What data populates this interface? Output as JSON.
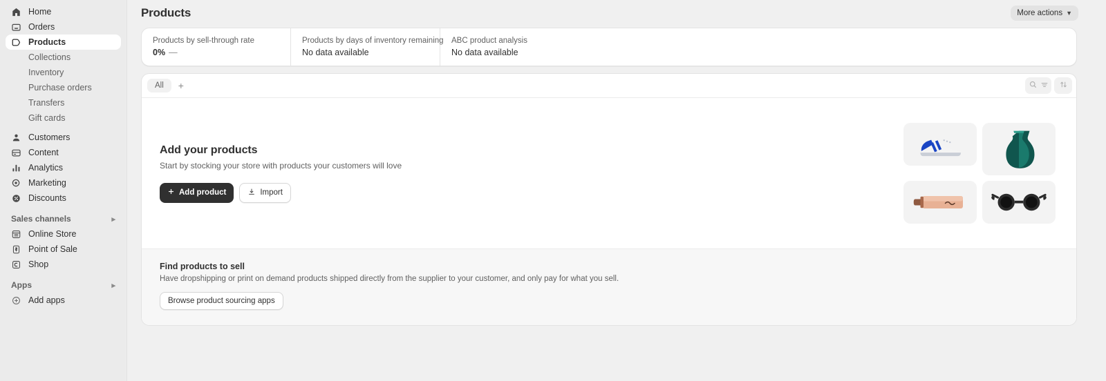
{
  "sidebar": {
    "primary": [
      {
        "label": "Home",
        "icon": "home-icon",
        "selected": false
      },
      {
        "label": "Orders",
        "icon": "orders-icon",
        "selected": false
      },
      {
        "label": "Products",
        "icon": "products-tag-icon",
        "selected": true
      }
    ],
    "product_subitems": [
      {
        "label": "Collections"
      },
      {
        "label": "Inventory"
      },
      {
        "label": "Purchase orders"
      },
      {
        "label": "Transfers"
      },
      {
        "label": "Gift cards"
      }
    ],
    "secondary": [
      {
        "label": "Customers",
        "icon": "customer-icon"
      },
      {
        "label": "Content",
        "icon": "content-icon"
      },
      {
        "label": "Analytics",
        "icon": "analytics-bars-icon"
      },
      {
        "label": "Marketing",
        "icon": "marketing-target-icon"
      },
      {
        "label": "Discounts",
        "icon": "discount-tag-icon"
      }
    ],
    "sales_channels": {
      "title": "Sales channels",
      "chevron": "chevron-right-icon",
      "items": [
        {
          "label": "Online Store",
          "icon": "online-store-icon"
        },
        {
          "label": "Point of Sale",
          "icon": "point-of-sale-icon"
        },
        {
          "label": "Shop",
          "icon": "shop-icon"
        }
      ]
    },
    "apps": {
      "title": "Apps",
      "chevron": "chevron-right-icon",
      "items": [
        {
          "label": "Add apps",
          "icon": "plus-circle-icon"
        }
      ]
    }
  },
  "header": {
    "title": "Products",
    "more_actions_label": "More actions",
    "more_actions_icon": "chevron-down-icon"
  },
  "metrics": [
    {
      "label": "Products by sell-through rate",
      "value": "0%",
      "suffix": "—",
      "strong": true
    },
    {
      "label": "Products by days of inventory remaining",
      "value": "No data available",
      "suffix": "",
      "strong": false
    },
    {
      "label": "ABC product analysis",
      "value": "No data available",
      "suffix": "",
      "strong": false
    }
  ],
  "tabbar": {
    "tabs": [
      {
        "label": "All",
        "active": true
      }
    ],
    "add_tab_icon": "plus-icon",
    "search_icon": "search-icon",
    "filter_icon": "filter-lines-icon",
    "sort_icon": "sort-arrows-icon"
  },
  "empty_state": {
    "heading": "Add your products",
    "subtext": "Start by stocking your store with products your customers will love",
    "primary_button": {
      "label": "Add product",
      "icon": "plus-icon"
    },
    "secondary_button": {
      "label": "Import",
      "icon": "import-download-icon"
    },
    "tiles": [
      {
        "name": "sneaker-illustration"
      },
      {
        "name": "vase-illustration"
      },
      {
        "name": "cosmetic-tube-illustration"
      },
      {
        "name": "sunglasses-illustration"
      }
    ]
  },
  "find_products": {
    "heading": "Find products to sell",
    "subtext": "Have dropshipping or print on demand products shipped directly from the supplier to your customer, and only pay for what you sell.",
    "button_label": "Browse product sourcing apps"
  },
  "colors": {
    "sidebar_bg": "#ebebeb",
    "main_bg": "#f0f0f0",
    "card_bg": "#ffffff",
    "primary_button": "#303030",
    "text_primary": "#303030",
    "text_secondary": "#616161",
    "vase_teal": "#1a6b5f",
    "sneaker_blue": "#1a45c4"
  }
}
